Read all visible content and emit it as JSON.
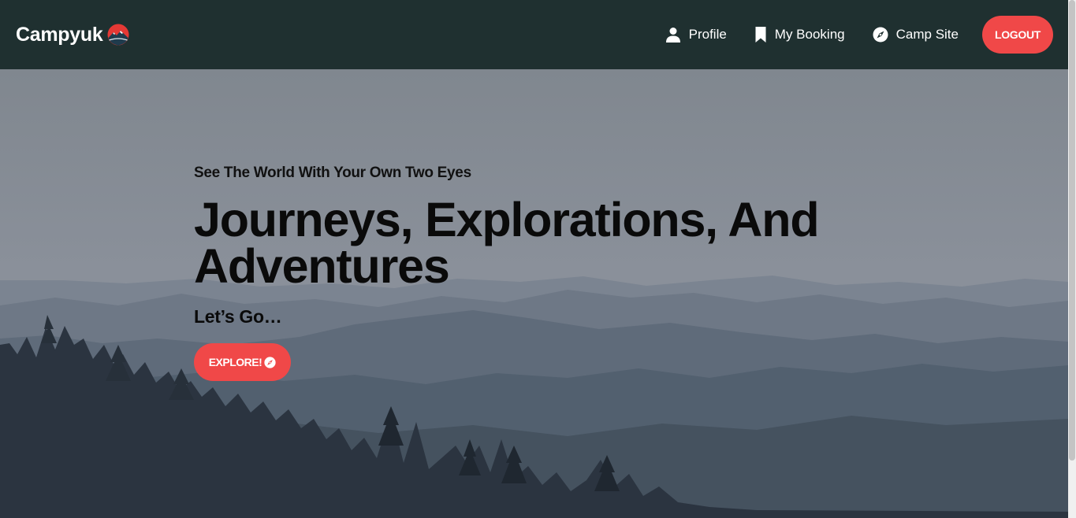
{
  "brand": {
    "name": "Campyuk",
    "logo_icon": "mountain-sun-icon"
  },
  "nav": {
    "items": [
      {
        "label": "Profile",
        "icon": "user-icon"
      },
      {
        "label": "My Booking",
        "icon": "bookmark-icon"
      },
      {
        "label": "Camp Site",
        "icon": "compass-icon"
      }
    ],
    "logout_label": "LOGOUT"
  },
  "hero": {
    "eyebrow": "See The World With Your Own Two Eyes",
    "headline": "Journeys, Explorations, And Adventures",
    "tagline": "Let’s Go…",
    "cta_label": "EXPLORE!",
    "cta_icon": "compass-icon"
  },
  "colors": {
    "navbar": "#1f3030",
    "accent": "#f04848",
    "text_dark": "#0a0a0a"
  }
}
